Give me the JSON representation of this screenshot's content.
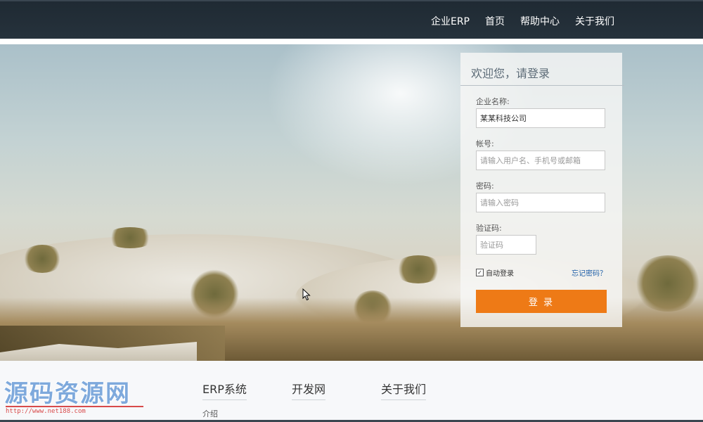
{
  "nav": {
    "items": [
      "企业ERP",
      "首页",
      "帮助中心",
      "关于我们"
    ]
  },
  "login": {
    "title": "欢迎您，请登录",
    "company_label": "企业名称:",
    "company_value": "某某科技公司",
    "account_label": "帐号:",
    "account_placeholder": "请输入用户名、手机号或邮箱",
    "password_label": "密码:",
    "password_placeholder": "请输入密码",
    "captcha_label": "验证码:",
    "captcha_placeholder": "验证码",
    "auto_login_label": "自动登录",
    "auto_login_checked": true,
    "forgot_label": "忘记密码？",
    "submit_label": "登 录"
  },
  "footer": {
    "watermark_text": "源码资源网",
    "watermark_url": "http://www.net188.com",
    "columns": [
      "ERP系统",
      "开发网",
      "关于我们"
    ],
    "sub_label": "介绍"
  },
  "colors": {
    "nav_bg": "#232e37",
    "accent": "#ee7a16",
    "link": "#1f5fa8"
  }
}
